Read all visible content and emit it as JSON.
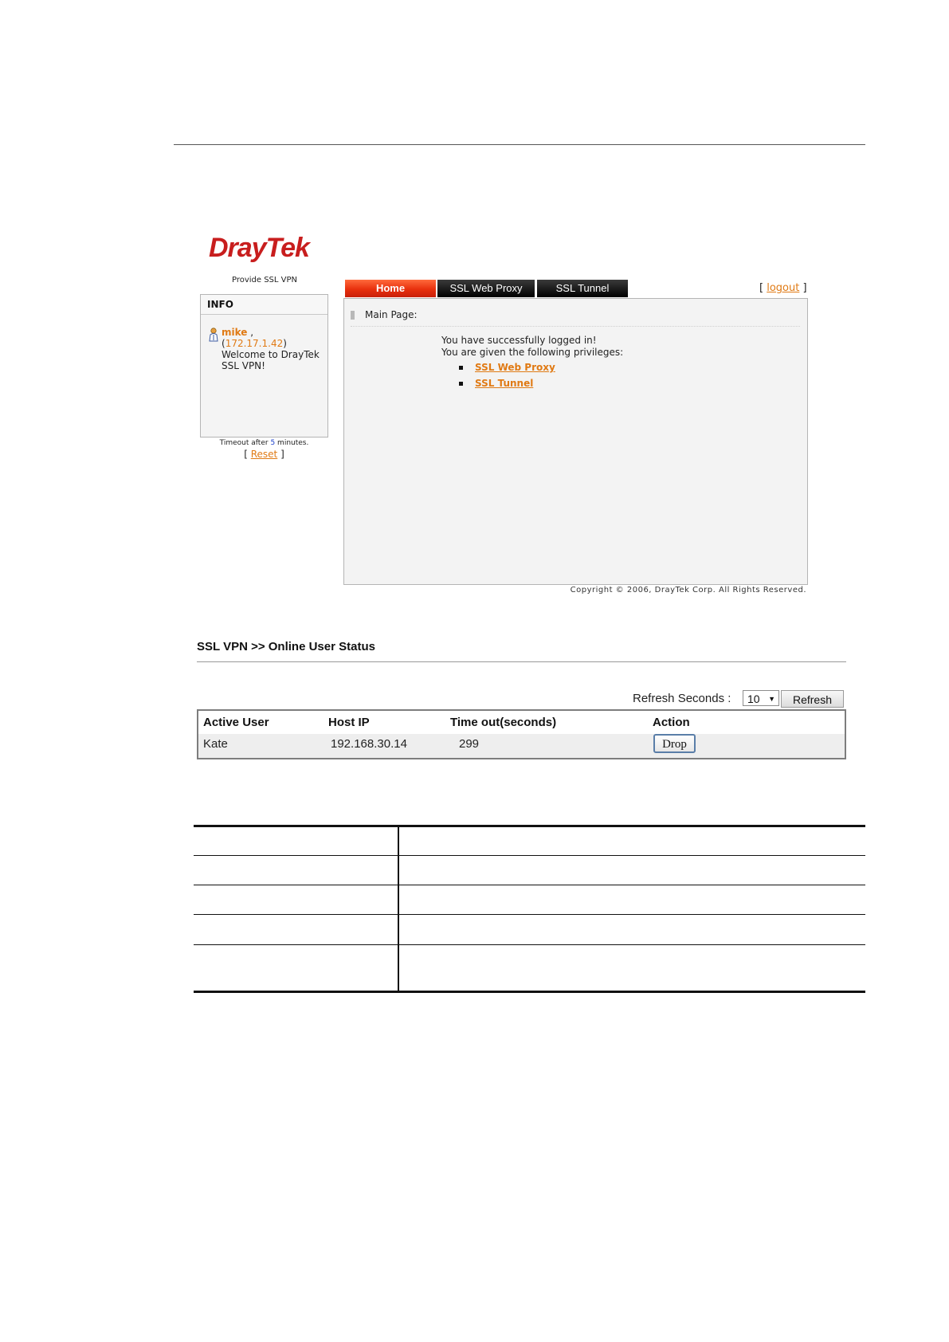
{
  "logo": {
    "text": "DrayTek",
    "subtitle": "Provide SSL VPN"
  },
  "info": {
    "title": "INFO",
    "user_name": "mike",
    "user_ip": "172.17.1.42",
    "welcome": "Welcome to DrayTek SSL VPN!",
    "timeout_prefix": "Timeout after",
    "timeout_value": "5",
    "timeout_suffix": "minutes.",
    "reset_label": "Reset"
  },
  "tabs": [
    "Home",
    "SSL Web Proxy",
    "SSL Tunnel"
  ],
  "logout_label": "logout",
  "main": {
    "heading": "Main Page:",
    "line1": "You have successfully logged in!",
    "line2": "You are given the following privileges:",
    "privileges": [
      "SSL Web Proxy",
      "SSL Tunnel"
    ]
  },
  "copyright": "Copyright © 2006, DrayTek Corp. All Rights Reserved.",
  "status": {
    "title": "SSL VPN >> Online User Status",
    "refresh_label": "Refresh Seconds :",
    "refresh_value": "10",
    "refresh_button": "Refresh",
    "columns": [
      "Active User",
      "Host IP",
      "Time out(seconds)",
      "Action"
    ],
    "rows": [
      {
        "user": "Kate",
        "ip": "192.168.30.14",
        "timeout": "299",
        "action": "Drop"
      }
    ]
  },
  "colors": {
    "brand_red": "#c81e1e",
    "link_orange": "#e07a14",
    "tab_active": "#e8300d"
  }
}
